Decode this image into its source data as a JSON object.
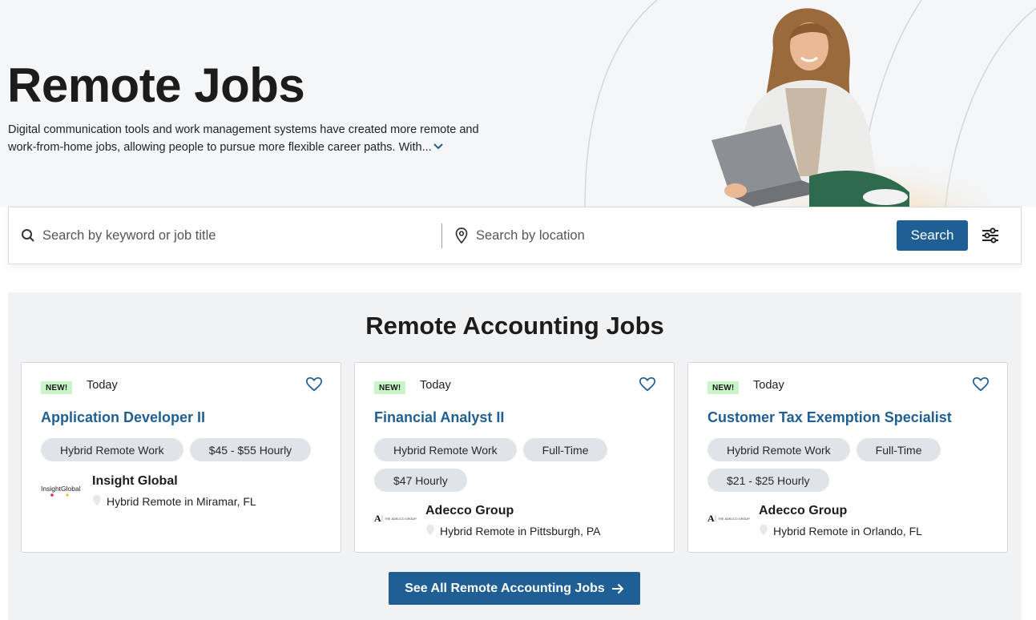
{
  "hero": {
    "title": "Remote Jobs",
    "description": "Digital communication tools and work management systems have created more remote and work-from-home jobs, allowing people to pursue more flexible career paths. With...",
    "expand_icon": "chevron-down-icon"
  },
  "search": {
    "keyword_placeholder": "Search by keyword or job title",
    "keyword_value": "",
    "keyword_icon": "search-icon",
    "location_placeholder": "Search by location",
    "location_value": "",
    "location_icon": "map-pin-icon",
    "button_label": "Search",
    "filter_icon": "sliders-icon"
  },
  "section": {
    "title": "Remote Accounting Jobs",
    "see_all_label": "See All Remote Accounting Jobs",
    "see_all_icon": "arrow-right-icon"
  },
  "jobs": [
    {
      "badge": "NEW!",
      "posted": "Today",
      "title": "Application Developer II",
      "tags": [
        "Hybrid Remote Work",
        "$45 - $55 Hourly"
      ],
      "company": "Insight Global",
      "location": "Hybrid Remote in Miramar, FL",
      "logo_text": "InsightGlobal"
    },
    {
      "badge": "NEW!",
      "posted": "Today",
      "title": "Financial Analyst II",
      "tags": [
        "Hybrid Remote Work",
        "Full-Time",
        "$47 Hourly"
      ],
      "company": "Adecco Group",
      "location": "Hybrid Remote in Pittsburgh, PA",
      "logo_text": "THE ADECCO GROUP"
    },
    {
      "badge": "NEW!",
      "posted": "Today",
      "title": "Customer Tax Exemption Specialist",
      "tags": [
        "Hybrid Remote Work",
        "Full-Time",
        "$21 - $25 Hourly"
      ],
      "company": "Adecco Group",
      "location": "Hybrid Remote in Orlando, FL",
      "logo_text": "THE ADECCO GROUP"
    }
  ],
  "colors": {
    "primary": "#1f5f93",
    "new_badge": "#c9f5c7",
    "tag_bg": "#dfe4e9",
    "hero_bg": "#f4f6f8"
  }
}
